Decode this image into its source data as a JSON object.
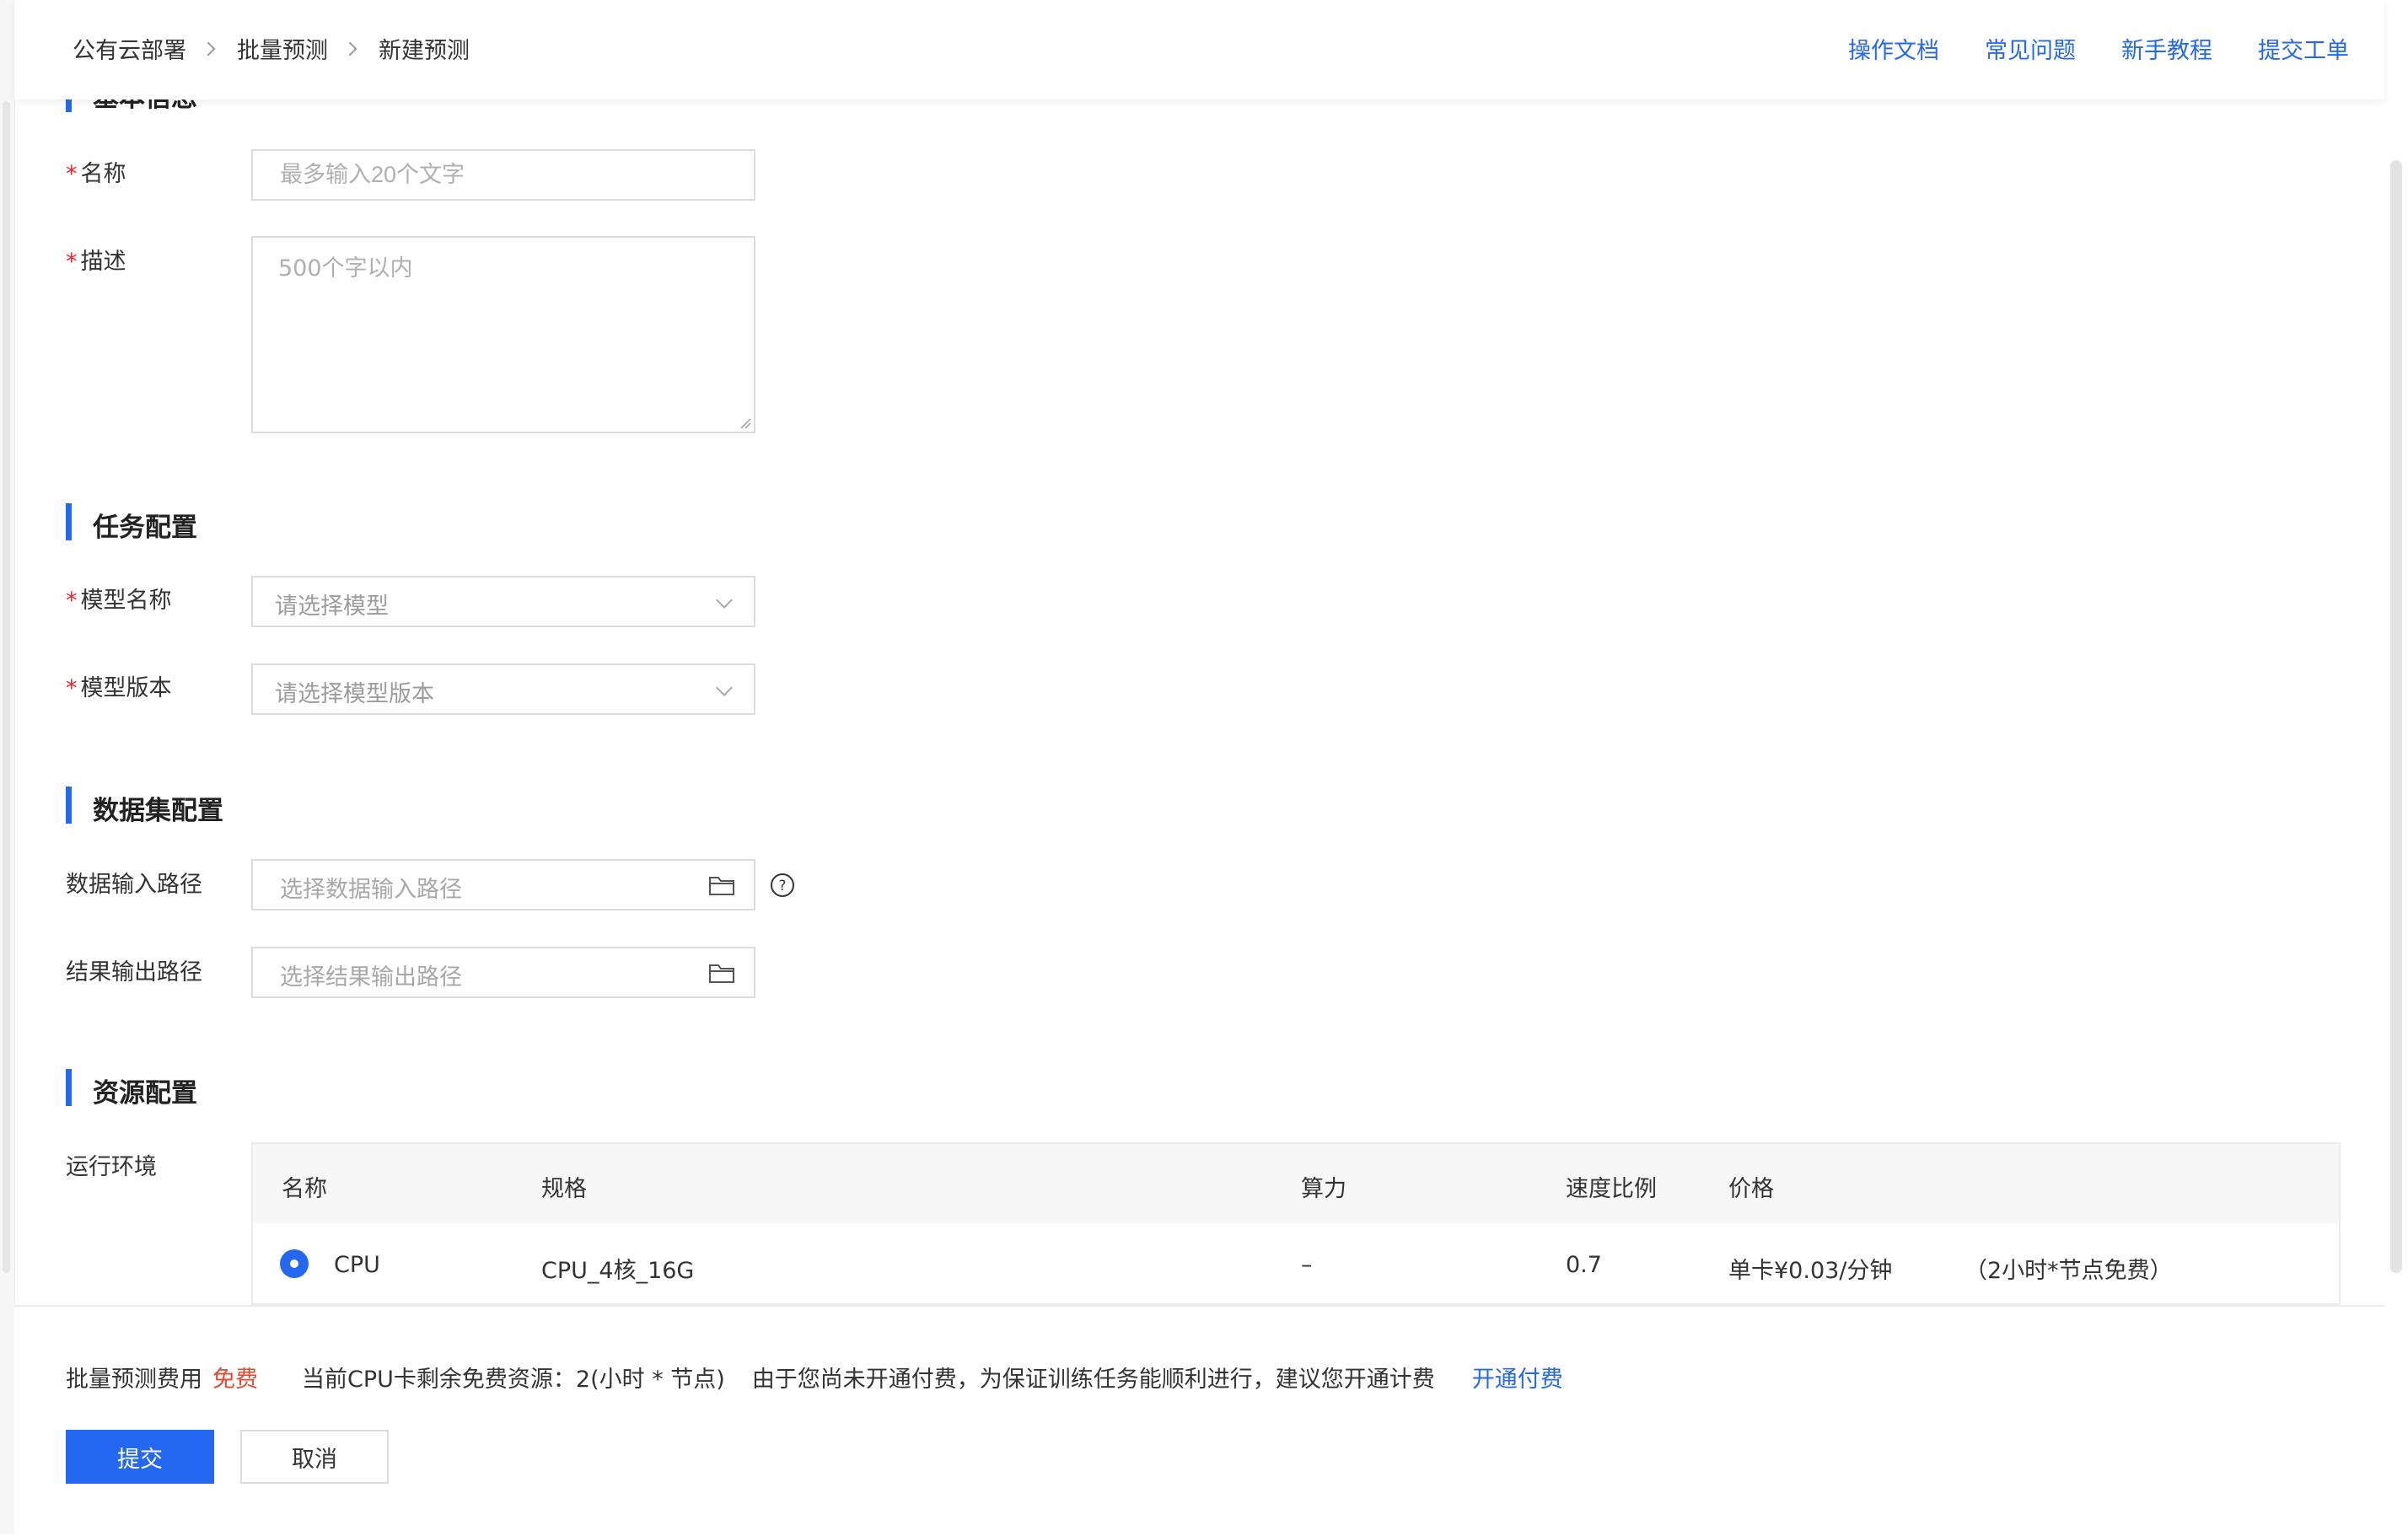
{
  "breadcrumb": [
    "公有云部署",
    "批量预测",
    "新建预测"
  ],
  "header_links": [
    "操作文档",
    "常见问题",
    "新手教程",
    "提交工单"
  ],
  "sections": {
    "basic": "基本信息",
    "task": "任务配置",
    "dataset": "数据集配置",
    "resource": "资源配置"
  },
  "fields": {
    "name_label": "名称",
    "name_placeholder": "最多输入20个文字",
    "desc_label": "描述",
    "desc_placeholder": "500个字以内",
    "model_name_label": "模型名称",
    "model_name_placeholder": "请选择模型",
    "model_version_label": "模型版本",
    "model_version_placeholder": "请选择模型版本",
    "input_path_label": "数据输入路径",
    "input_path_placeholder": "选择数据输入路径",
    "output_path_label": "结果输出路径",
    "output_path_placeholder": "选择结果输出路径",
    "runtime_label": "运行环境",
    "required_mark": "*"
  },
  "table": {
    "headers": [
      "名称",
      "规格",
      "算力",
      "速度比例",
      "价格"
    ],
    "rows": [
      {
        "name": "CPU",
        "spec": "CPU_4核_16G",
        "power": "–",
        "speed": "0.7",
        "price": "单卡¥0.03/分钟",
        "note": "（2小时*节点免费）",
        "selected": true
      }
    ]
  },
  "footer": {
    "fee_label": "批量预测费用",
    "fee_value": "免费",
    "free_resource": "当前CPU卡剩余免费资源：2(小时 * 节点)",
    "suggestion": "由于您尚未开通付费，为保证训练任务能顺利进行，建议您开通计费",
    "open_pay_link": "开通付费",
    "submit": "提交",
    "cancel": "取消"
  },
  "colors": {
    "accent": "#2468f2",
    "required": "#f5222d",
    "free": "#e8492f"
  },
  "icons": [
    "folder-icon",
    "help-circle-icon",
    "chevron-down-icon",
    "chevron-right-icon",
    "radio-selected-icon"
  ]
}
